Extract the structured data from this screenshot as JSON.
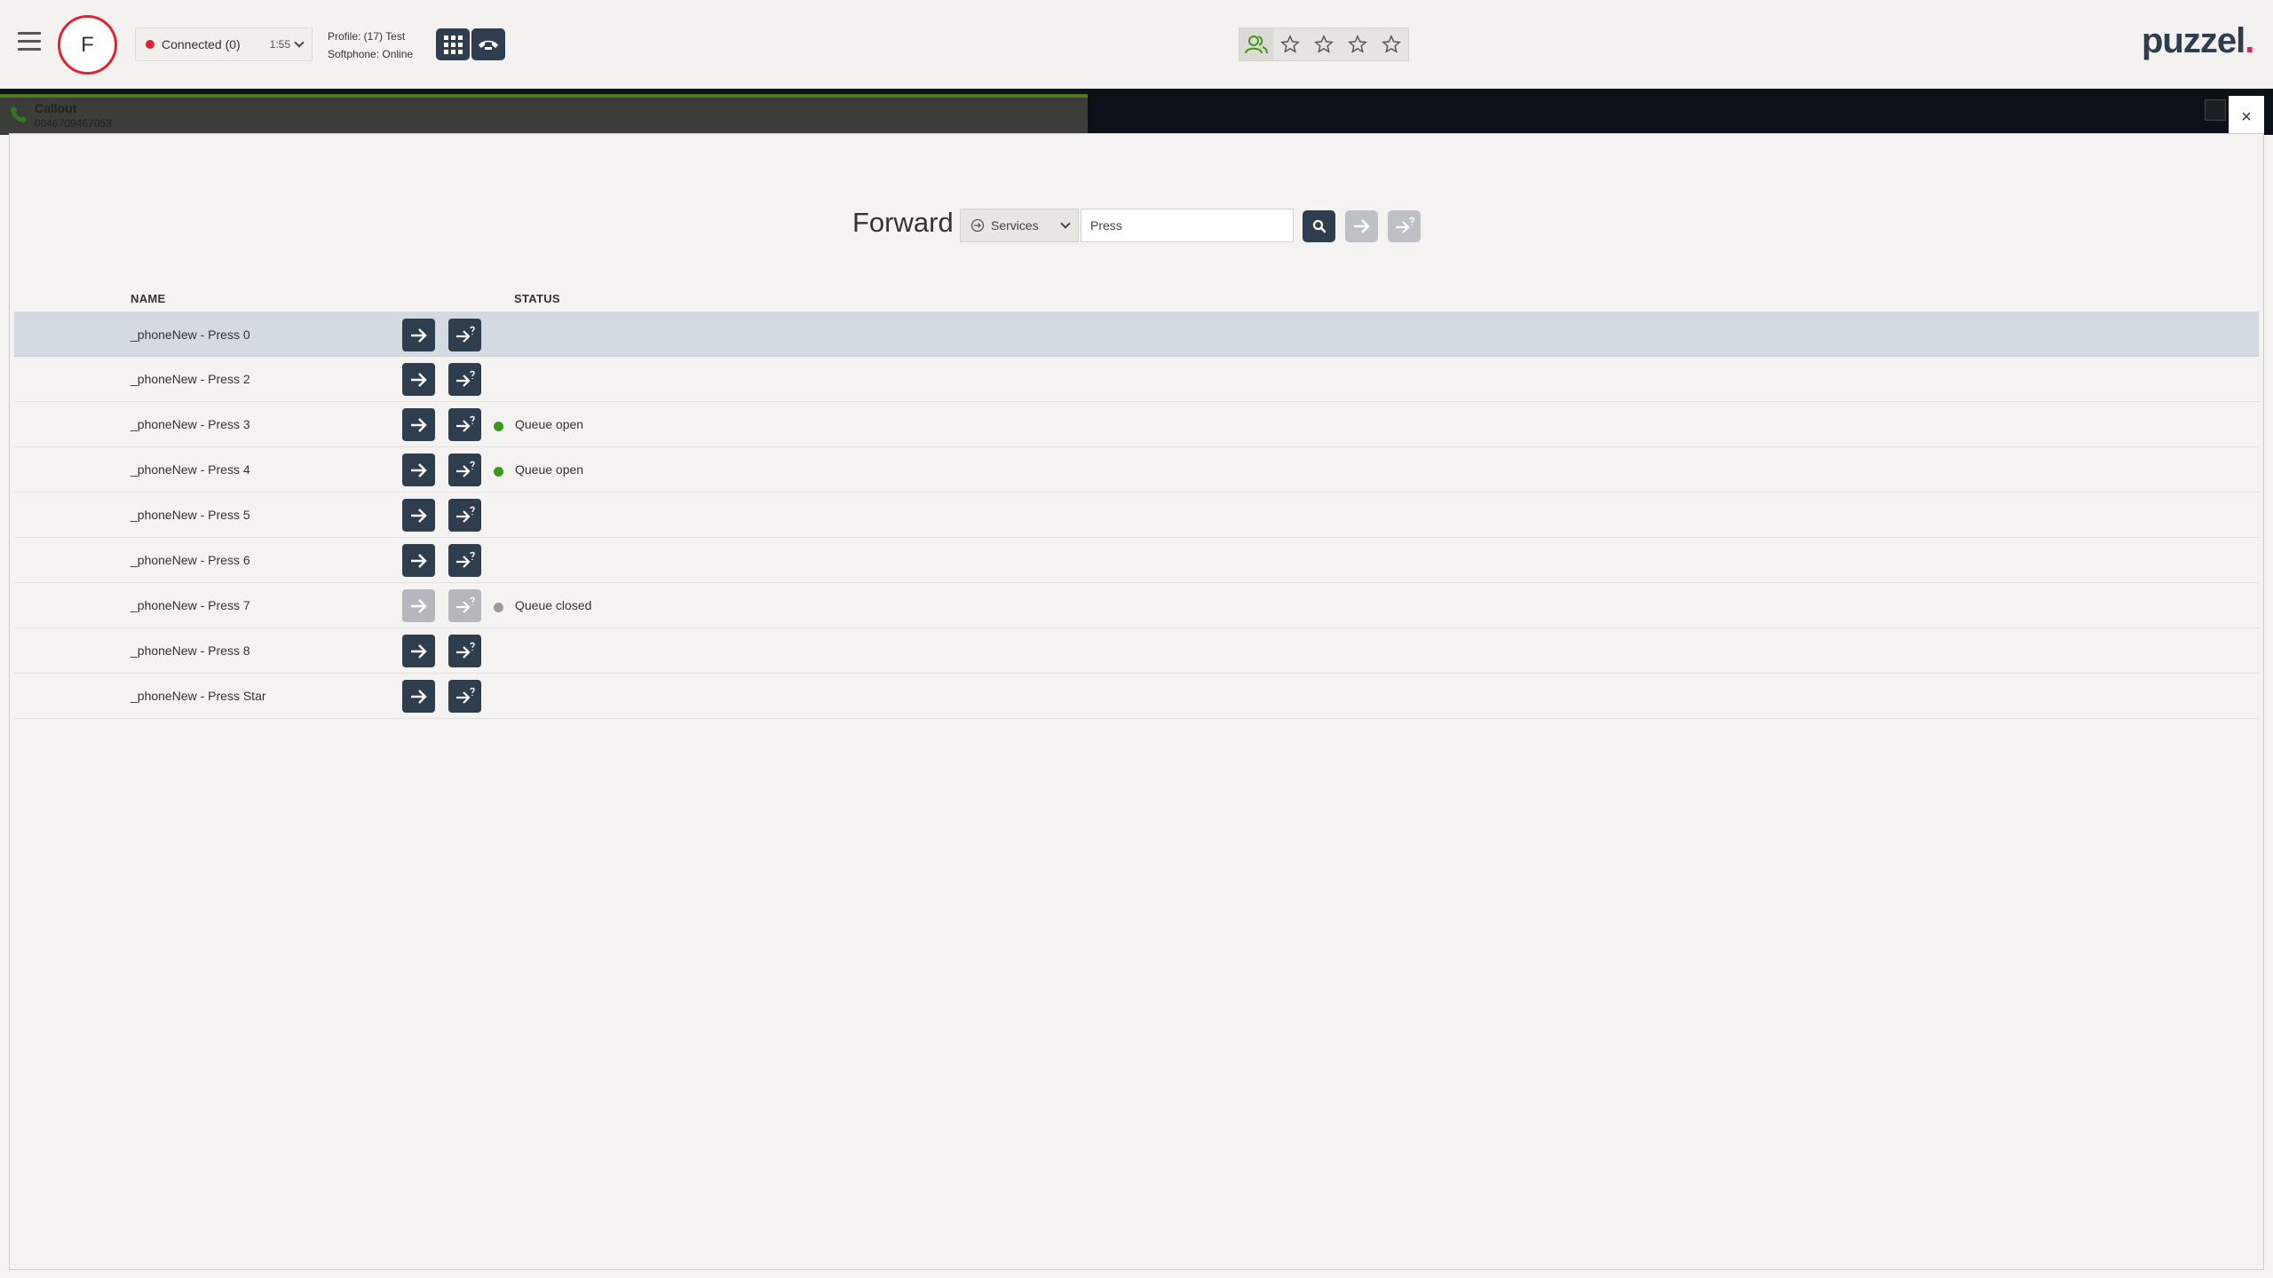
{
  "header": {
    "avatar_letter": "F",
    "status": {
      "label": "Connected (0)",
      "time": "1:55",
      "dot_color": "#e0242f"
    },
    "profile_line": "Profile: (17) Test",
    "softphone_line": "Softphone: Online",
    "dialpad_icon": "dialpad-icon",
    "hangup_icon": "phone-hangup-icon",
    "favorites": [
      "agent-group-icon",
      "star-icon",
      "star-icon",
      "star-icon",
      "star-icon"
    ],
    "logo": {
      "text": "puzzel",
      "dot": "."
    }
  },
  "call": {
    "title": "Callout",
    "number": "0046709467053"
  },
  "close_label": "×",
  "forward": {
    "title": "Forward",
    "type_select": "Services",
    "search_placeholder": "Press",
    "columns": {
      "name": "NAME",
      "status": "STATUS"
    },
    "rows": [
      {
        "name": "_phoneNew - Press 0",
        "status": "",
        "dot": "",
        "enabled": true,
        "selected": true
      },
      {
        "name": "_phoneNew - Press 2",
        "status": "",
        "dot": "",
        "enabled": true
      },
      {
        "name": "_phoneNew - Press 3",
        "status": "Queue open",
        "dot": "#3a9a1c",
        "enabled": true
      },
      {
        "name": "_phoneNew - Press 4",
        "status": "Queue open",
        "dot": "#3a9a1c",
        "enabled": true
      },
      {
        "name": "_phoneNew - Press 5",
        "status": "",
        "dot": "",
        "enabled": true
      },
      {
        "name": "_phoneNew - Press 6",
        "status": "",
        "dot": "",
        "enabled": true
      },
      {
        "name": "_phoneNew - Press 7",
        "status": "Queue closed",
        "dot": "#9a9a9a",
        "enabled": false
      },
      {
        "name": "_phoneNew - Press 8",
        "status": "",
        "dot": "",
        "enabled": true
      },
      {
        "name": "_phoneNew - Press Star",
        "status": "",
        "dot": "",
        "enabled": true
      }
    ]
  },
  "colors": {
    "accent_dark": "#2e3e4e",
    "brand_red": "#e0242f",
    "row_selected": "#d3dae2"
  }
}
